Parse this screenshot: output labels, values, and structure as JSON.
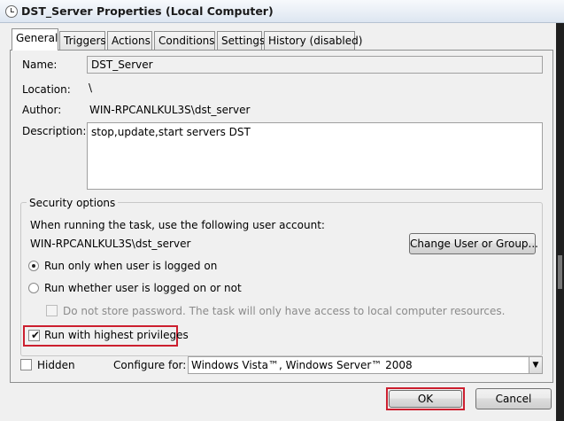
{
  "window": {
    "title": "DST_Server Properties (Local Computer)"
  },
  "tabs": [
    {
      "label": "General"
    },
    {
      "label": "Triggers"
    },
    {
      "label": "Actions"
    },
    {
      "label": "Conditions"
    },
    {
      "label": "Settings"
    },
    {
      "label": "History (disabled)"
    }
  ],
  "general": {
    "name_label": "Name:",
    "name_value": "DST_Server",
    "location_label": "Location:",
    "location_value": "\\",
    "author_label": "Author:",
    "author_value": "WIN-RPCANLKUL3S\\dst_server",
    "description_label": "Description:",
    "description_value": "stop,update,start servers DST"
  },
  "security": {
    "legend": "Security options",
    "account_prompt": "When running the task, use the following user account:",
    "account_value": "WIN-RPCANLKUL3S\\dst_server",
    "change_button": "Change User or Group...",
    "radio_logged_on": "Run only when user is logged on",
    "radio_whether": "Run whether user is logged on or not",
    "store_password": "Do not store password.  The task will only have access to local computer resources.",
    "highest_privileges": "Run with highest privileges",
    "highest_checked": true
  },
  "bottom": {
    "hidden_label": "Hidden",
    "configure_label": "Configure for:",
    "configure_value": "Windows Vista™, Windows Server™ 2008"
  },
  "buttons": {
    "ok": "OK",
    "cancel": "Cancel"
  },
  "colors": {
    "highlight": "#cc1f2f"
  }
}
